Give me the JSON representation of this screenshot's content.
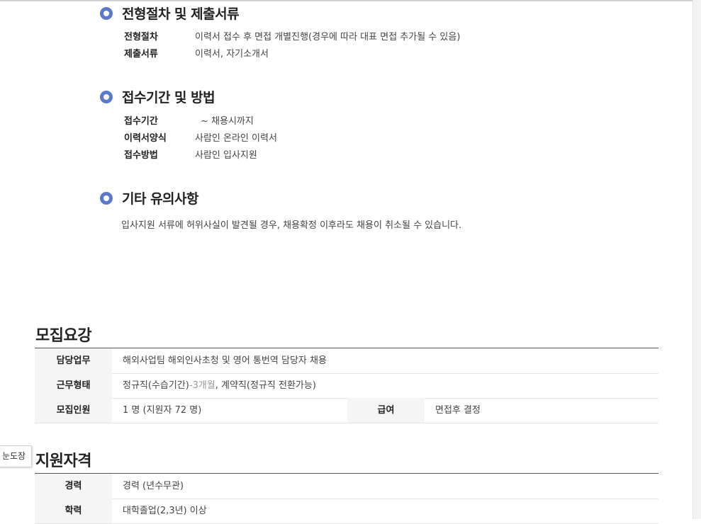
{
  "sections": [
    {
      "title": "전형절차 및 제출서류",
      "rows": [
        {
          "label": "전형절차",
          "value": "이력서 접수 후 면접 개별진행(경우에 따라 대표 면접 추가될 수 있음)"
        },
        {
          "label": "제출서류",
          "value": "이력서, 자기소개서"
        }
      ]
    },
    {
      "title": "접수기간 및 방법",
      "rows": [
        {
          "label": "접수기간",
          "value": "~ 채용시까지"
        },
        {
          "label": "이력서양식",
          "value": "사람인 온라인 이력서"
        },
        {
          "label": "접수방법",
          "value": "사람인 입사지원"
        }
      ]
    },
    {
      "title": "기타 유의사항",
      "note": "입사지원 서류에 허위사실이 발견될 경우, 채용확정 이후라도 채용이 취소될 수 있습니다."
    }
  ],
  "recruit": {
    "heading": "모집요강",
    "duty_label": "담당업무",
    "duty_value": "해외사업팀 해외인사초청 및 영어 통번역 담당자 채용",
    "type_label": "근무형태",
    "type_value_a": "정규직(수습기간)",
    "type_value_b": "-3개월",
    "type_value_c": ", 계약직(정규직 전환가능)",
    "headcount_label": "모집인원",
    "headcount_value": "1 명 (지원자 72 명)",
    "salary_label": "급여",
    "salary_value": "면접후 결정"
  },
  "qualification": {
    "heading": "지원자격",
    "career_label": "경력",
    "career_value": "경력 (년수무관)",
    "edu_label": "학력",
    "edu_value": "대학졸업(2,3년) 이상"
  },
  "side_tab": {
    "label": "눈도장"
  }
}
